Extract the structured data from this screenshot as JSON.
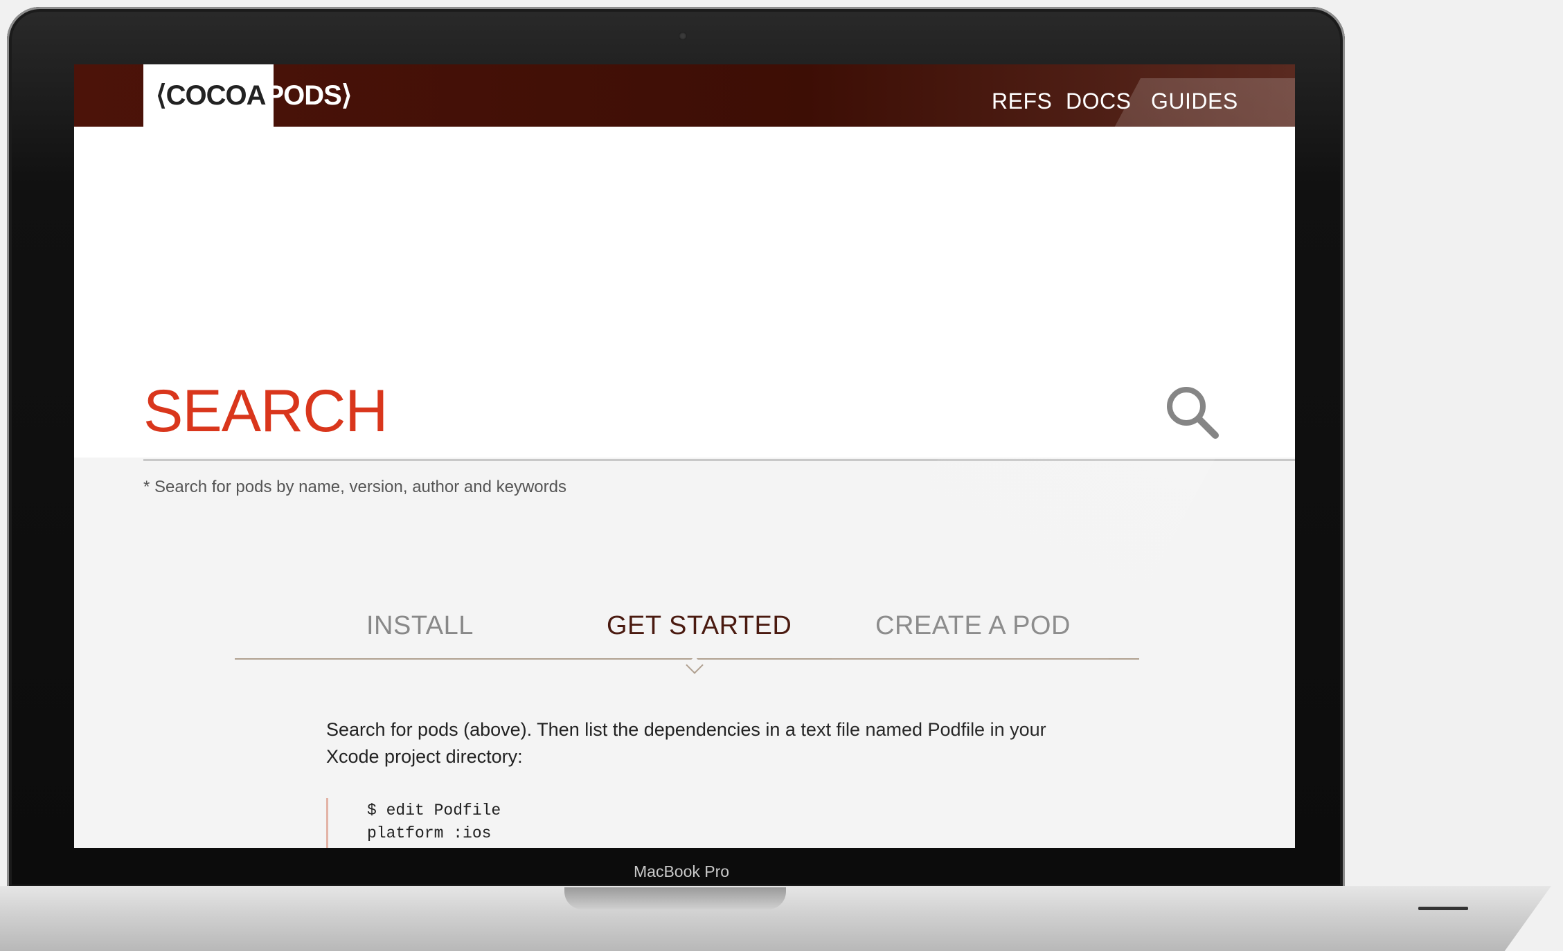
{
  "header": {
    "logo_left": "⟨COCOA",
    "logo_right": "PODS⟩",
    "nav": [
      "REFS",
      "DOCS",
      "GUIDES"
    ]
  },
  "search": {
    "title": "SEARCH",
    "hint": "* Search for pods by name, version, author and keywords"
  },
  "tabs": [
    "INSTALL",
    "GET STARTED",
    "CREATE A POD"
  ],
  "content": {
    "description": "Search for pods (above). Then list the dependencies in a text file named Podfile in your Xcode project directory:",
    "code": "$ edit Podfile\nplatform :ios"
  },
  "device": {
    "label": "MacBook Pro"
  },
  "colors": {
    "brand_dark": "#4c1309",
    "search_red": "#d9361c"
  }
}
